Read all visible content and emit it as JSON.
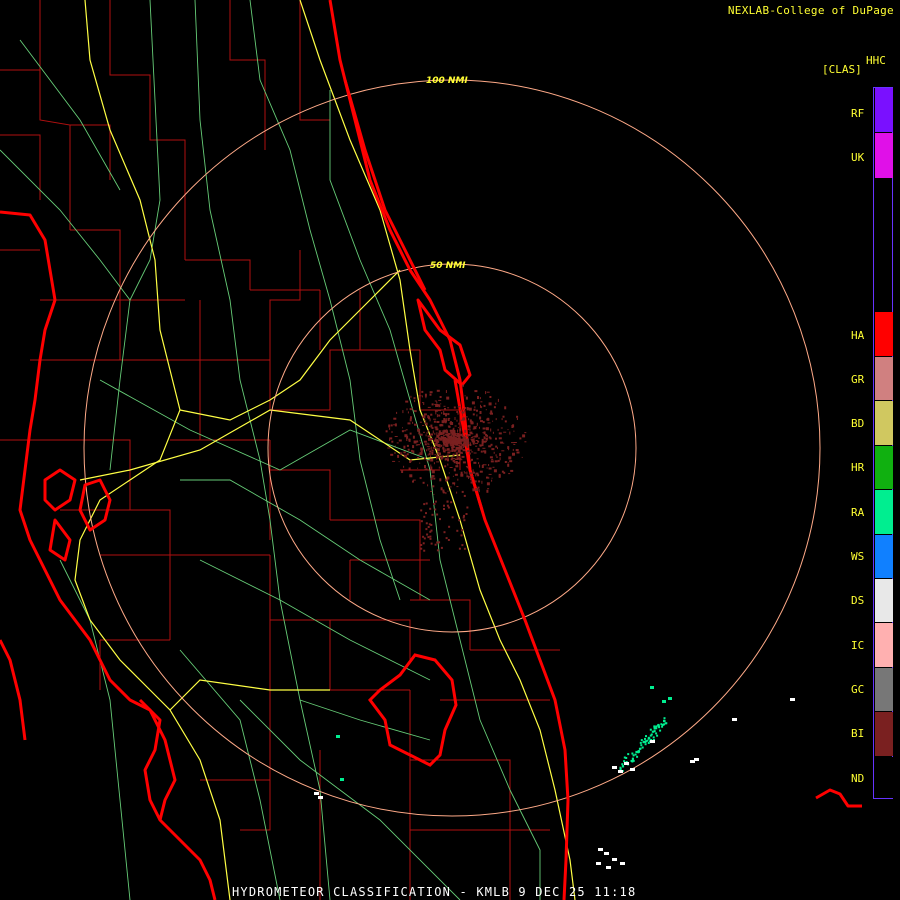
{
  "credit": "NEXLAB-College of DuPage",
  "footer": "HYDROMETEOR CLASSIFICATION - KMLB 9 DEC 25 11:18",
  "ring_labels": {
    "inner": "50 NMI",
    "outer": "100 NMI"
  },
  "legend": {
    "product_code": "HHC",
    "units": "[CLAS]",
    "classes": [
      {
        "code": "RF",
        "color": "#7a10ff"
      },
      {
        "code": "UK",
        "color": "#e010e8"
      },
      {
        "code": "HA",
        "color": "#ff0000"
      },
      {
        "code": "GR",
        "color": "#d08080"
      },
      {
        "code": "BD",
        "color": "#d0c860"
      },
      {
        "code": "HR",
        "color": "#10b010"
      },
      {
        "code": "RA",
        "color": "#00ee90"
      },
      {
        "code": "WS",
        "color": "#1080ff"
      },
      {
        "code": "DS",
        "color": "#e8e8e8"
      },
      {
        "code": "IC",
        "color": "#ffb0b0"
      },
      {
        "code": "GC",
        "color": "#777777"
      },
      {
        "code": "BI",
        "color": "#7a2020"
      },
      {
        "code": "ND",
        "color": "#000000"
      }
    ]
  },
  "colors": {
    "coast": "#ff0000",
    "county": "#b01010",
    "highway": "#ffff44",
    "road": "#66cc77",
    "range_ring": "#ffaa88",
    "biological": "#7a2020",
    "rain": "#00ee90",
    "dry_snow": "#ffffff"
  }
}
